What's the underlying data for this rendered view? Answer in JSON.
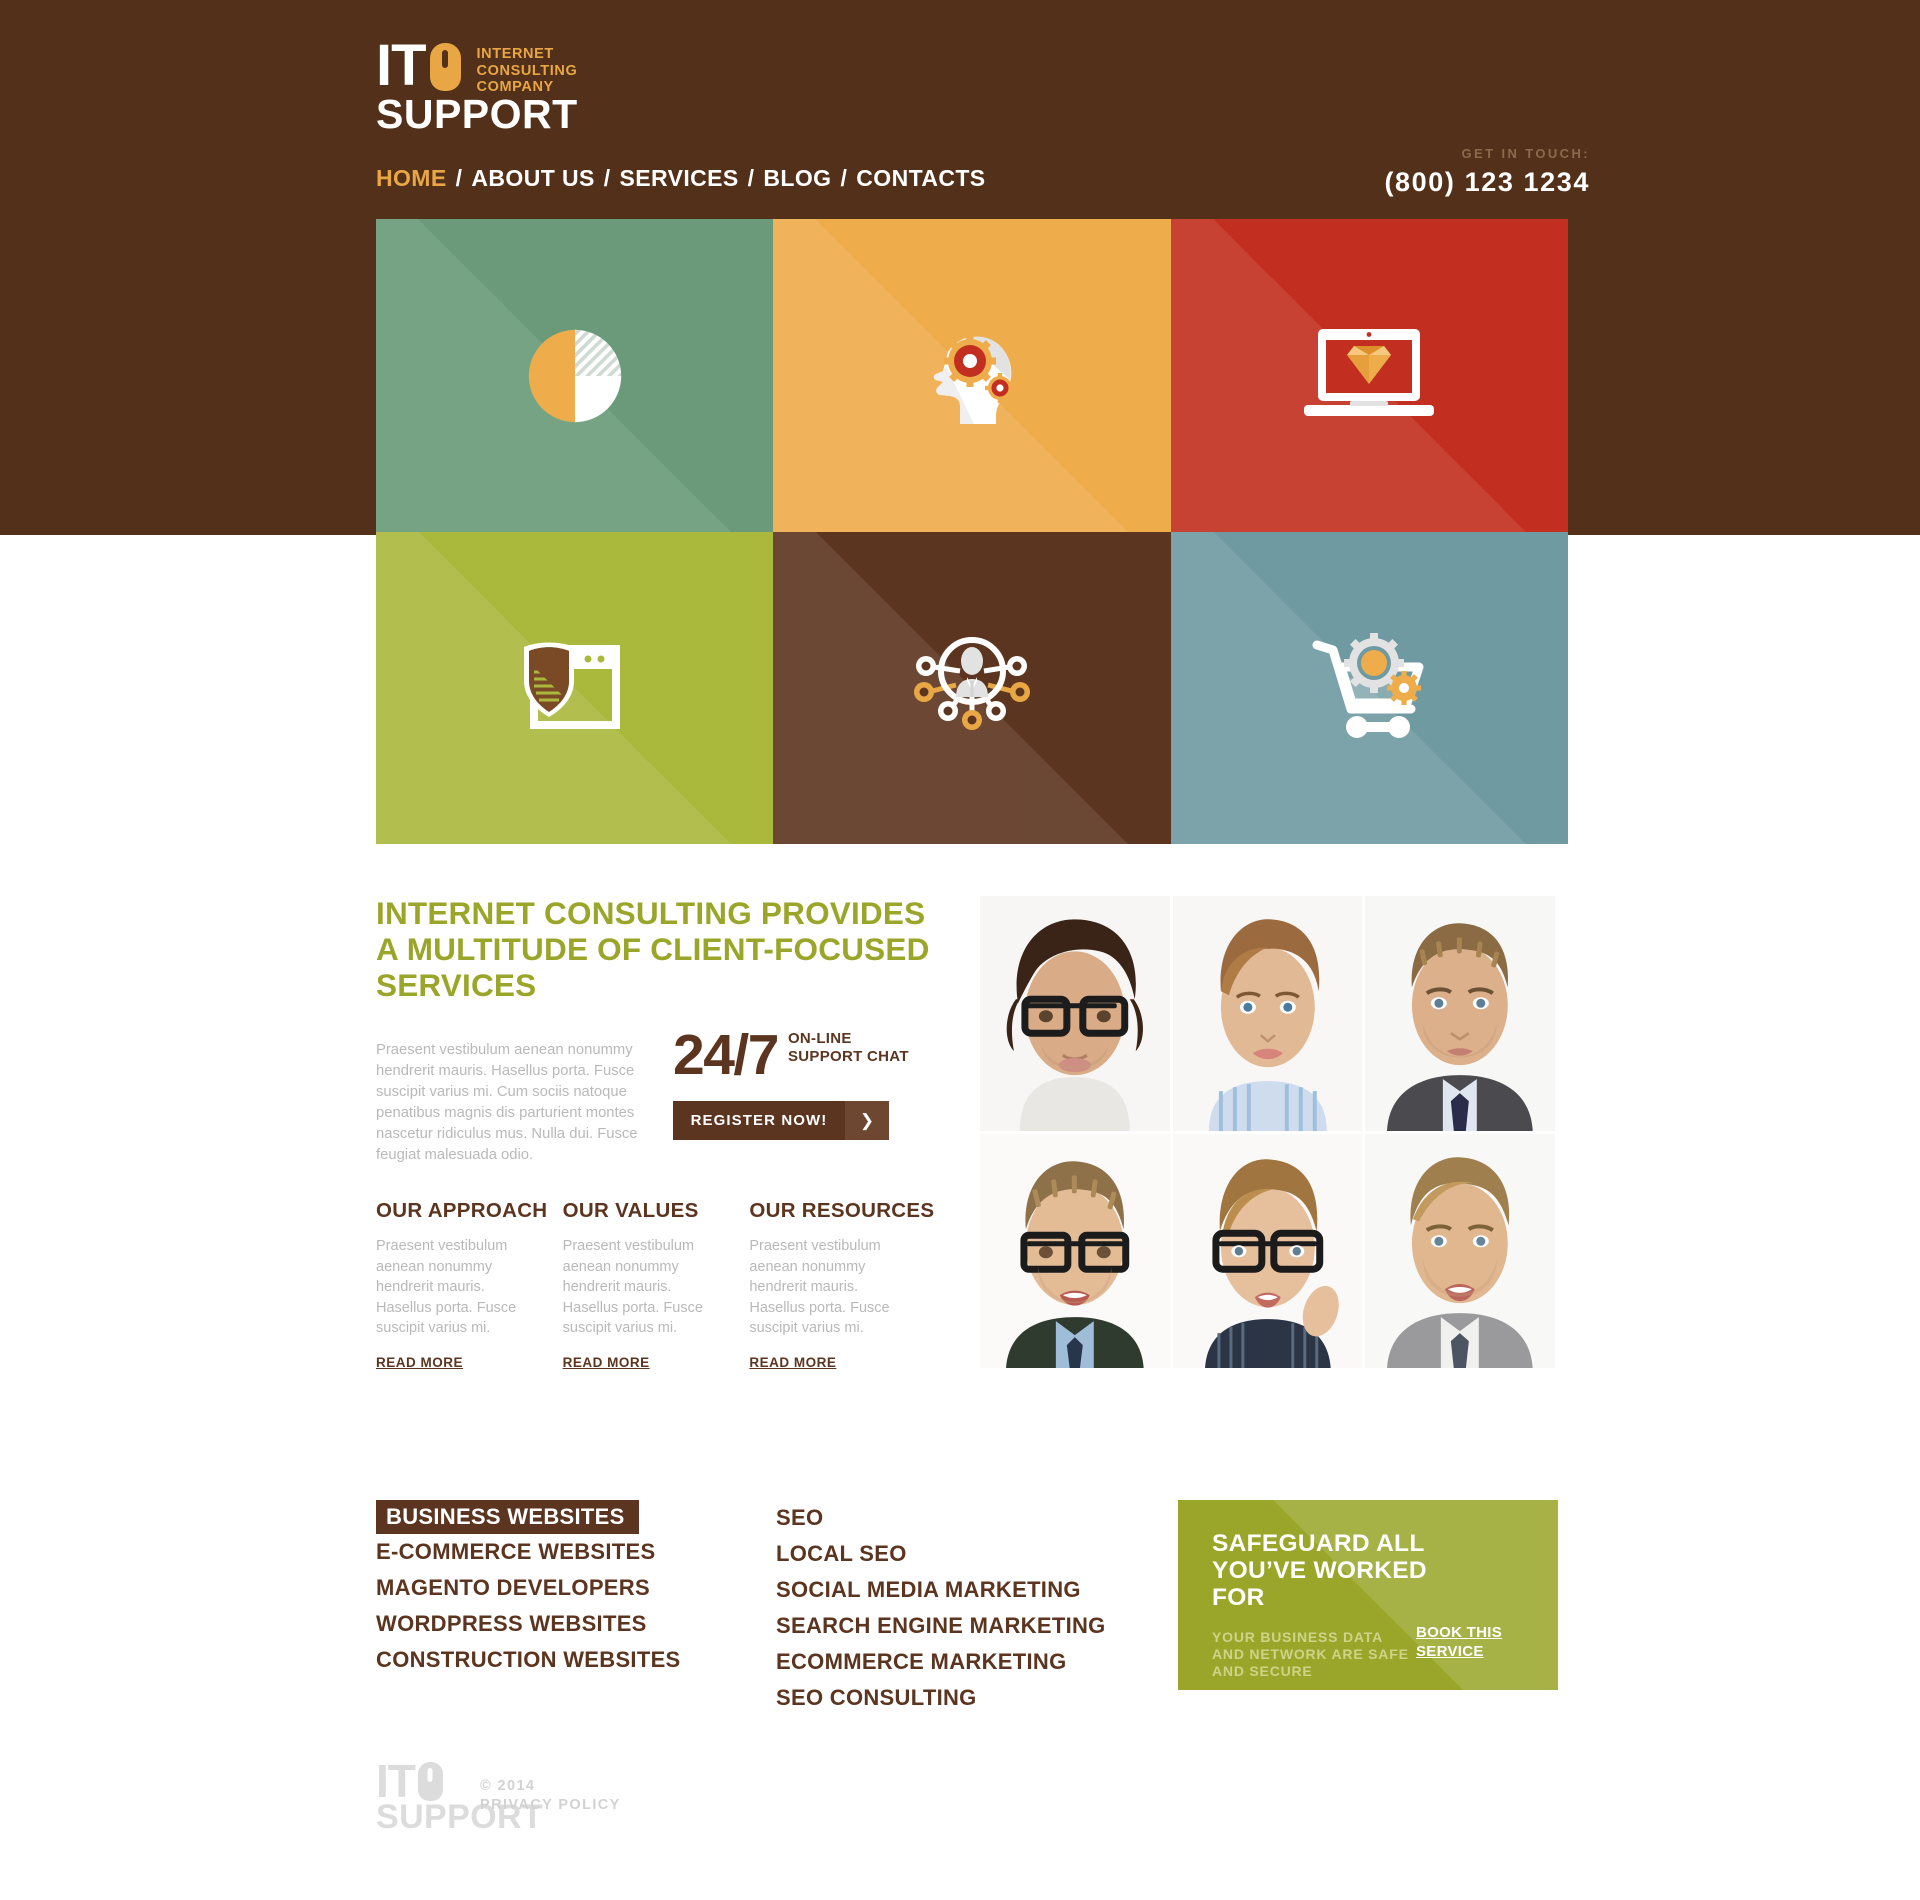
{
  "brand": {
    "it": "IT",
    "tagline_line1": "INTERNET",
    "tagline_line2": "CONSULTING",
    "tagline_line3": "COMPANY",
    "support": "SUPPORT",
    "mouse_icon": "mouse-icon"
  },
  "nav": {
    "items": [
      {
        "label": "HOME",
        "active": true
      },
      {
        "label": "ABOUT US",
        "active": false
      },
      {
        "label": "SERVICES",
        "active": false
      },
      {
        "label": "BLOG",
        "active": false
      },
      {
        "label": "CONTACTS",
        "active": false
      }
    ],
    "separator": "/"
  },
  "contact": {
    "label": "GET IN TOUCH:",
    "phone": "(800) 123 1234"
  },
  "tiles": [
    {
      "icon": "pie-chart-icon",
      "bg": "#6a9a79"
    },
    {
      "icon": "head-gears-icon",
      "bg": "#eeac4b"
    },
    {
      "icon": "laptop-diamond-icon",
      "bg": "#c22f20"
    },
    {
      "icon": "shield-browser-icon",
      "bg": "#aab93c"
    },
    {
      "icon": "network-person-icon",
      "bg": "#5c3520"
    },
    {
      "icon": "cart-gears-icon",
      "bg": "#6f9aa1"
    }
  ],
  "intro": {
    "heading": "INTERNET CONSULTING PROVIDES A MULTITUDE OF CLIENT-FOCUSED SERVICES",
    "paragraph": "Praesent vestibulum aenean nonummy hendrerit mauris. Hasellus porta. Fusce suscipit varius mi. Cum sociis natoque penatibus magnis dis parturient montes nascetur ridiculus mus. Nulla dui. Fusce feugiat malesuada odio.",
    "chat": {
      "big": "24/7",
      "label": "ON-LINE SUPPORT CHAT",
      "button": "REGISTER NOW!",
      "arrow": "❯"
    },
    "columns": [
      {
        "title": "OUR APPROACH",
        "body": "Praesent vestibulum aenean nonummy hendrerit mauris. Hasellus porta. Fusce suscipit varius mi.",
        "link": "READ MORE"
      },
      {
        "title": "OUR VALUES",
        "body": "Praesent vestibulum aenean nonummy hendrerit mauris. Hasellus porta. Fusce suscipit varius mi.",
        "link": "READ MORE"
      },
      {
        "title": "OUR RESOURCES",
        "body": "Praesent vestibulum aenean nonummy hendrerit mauris. Hasellus porta. Fusce suscipit varius mi.",
        "link": "READ MORE"
      }
    ],
    "team_photos": [
      {
        "name": "man-with-glasses-dark-hair"
      },
      {
        "name": "woman-short-hair-striped-shirt"
      },
      {
        "name": "man-in-suit-short-hair"
      },
      {
        "name": "smiling-man-with-glasses"
      },
      {
        "name": "smiling-woman-with-glasses"
      },
      {
        "name": "smiling-man-grey-suit"
      }
    ]
  },
  "services": {
    "column1": [
      {
        "label": "BUSINESS WEBSITES",
        "active": true
      },
      {
        "label": "E-COMMERCE WEBSITES",
        "active": false
      },
      {
        "label": "MAGENTO DEVELOPERS",
        "active": false
      },
      {
        "label": "WORDPRESS WEBSITES",
        "active": false
      },
      {
        "label": "CONSTRUCTION WEBSITES",
        "active": false
      }
    ],
    "column2": [
      {
        "label": "SEO",
        "active": false
      },
      {
        "label": "LOCAL SEO",
        "active": false
      },
      {
        "label": "SOCIAL MEDIA MARKETING",
        "active": false
      },
      {
        "label": "SEARCH ENGINE MARKETING",
        "active": false
      },
      {
        "label": "ECOMMERCE MARKETING",
        "active": false
      },
      {
        "label": "SEO CONSULTING",
        "active": false
      }
    ],
    "promo": {
      "heading": "SAFEGUARD ALL YOU’VE WORKED FOR",
      "subtext": "YOUR BUSINESS DATA AND NETWORK ARE SAFE AND SECURE",
      "link": "BOOK THIS SERVICE"
    }
  },
  "footer": {
    "it": "IT",
    "support": "SUPPORT",
    "copyright": "© 2014",
    "privacy": "PRIVACY POLICY"
  },
  "colors": {
    "brown": "#523019",
    "dark_brown": "#5c3520",
    "orange": "#e8a744",
    "olive": "#9aa62a",
    "grey_text": "#b9b9b9"
  }
}
